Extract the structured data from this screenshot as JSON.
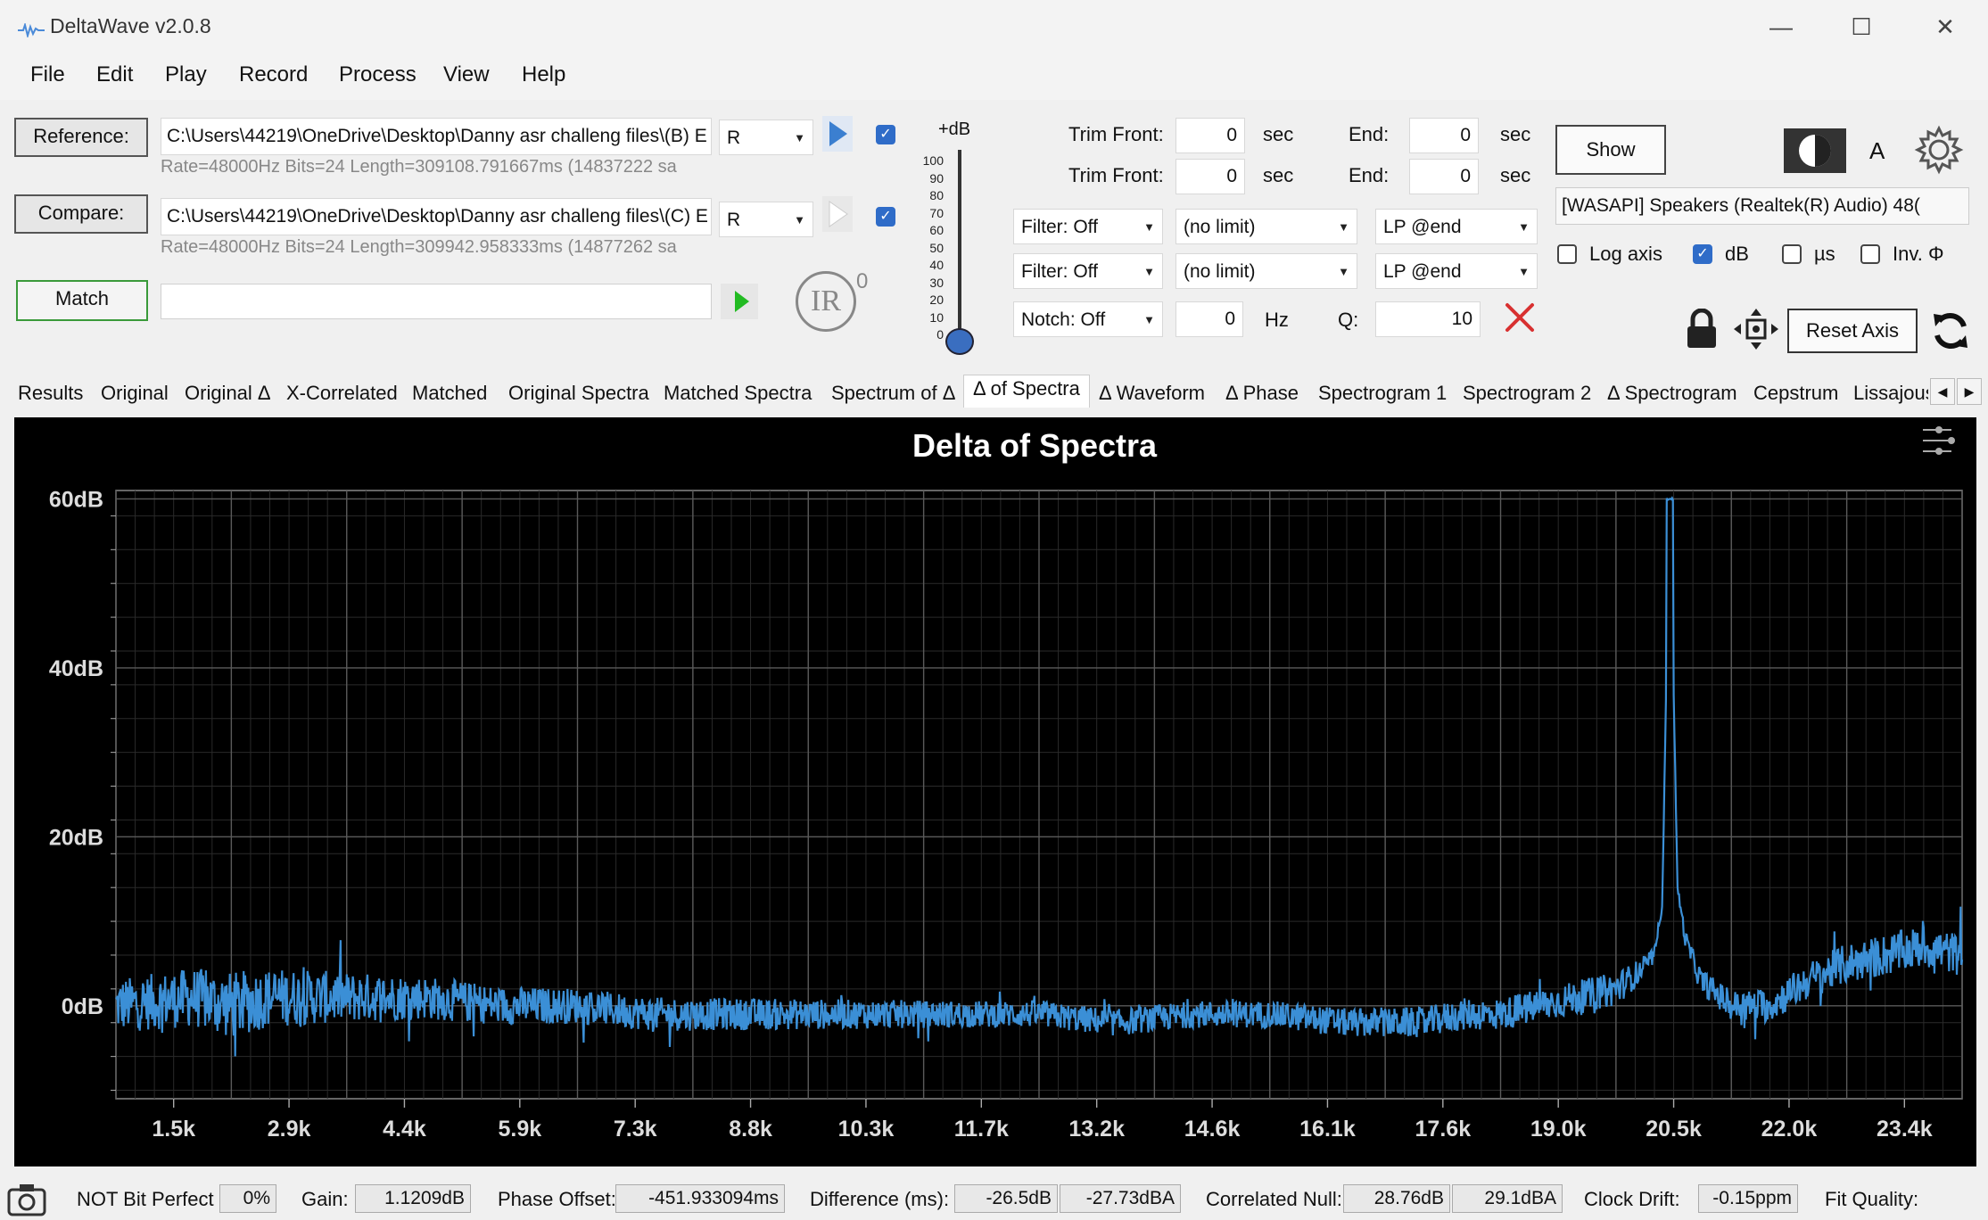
{
  "window": {
    "title": "DeltaWave v2.0.8",
    "minimize": "—",
    "maximize": "☐",
    "close": "✕"
  },
  "menu": [
    "File",
    "Edit",
    "Play",
    "Record",
    "Process",
    "View",
    "Help"
  ],
  "reference": {
    "button": "Reference:",
    "path": "C:\\Users\\44219\\OneDrive\\Desktop\\Danny asr challeng files\\(B) E",
    "channel": "R",
    "info": "Rate=48000Hz Bits=24 Length=309108.791667ms (14837222 sa"
  },
  "compare": {
    "button": "Compare:",
    "path": "C:\\Users\\44219\\OneDrive\\Desktop\\Danny asr challeng files\\(C) E",
    "channel": "R",
    "info": "Rate=48000Hz Bits=24 Length=309942.958333ms (14877262 sa"
  },
  "match": {
    "button": "Match",
    "ir_label": "IR",
    "ir_count": "0"
  },
  "level": {
    "label": "+dB",
    "ticks": [
      "100",
      "90",
      "80",
      "70",
      "60",
      "50",
      "40",
      "30",
      "20",
      "10",
      "0"
    ]
  },
  "trim": [
    {
      "label": "Trim Front:",
      "value": "0",
      "unit": "sec",
      "end_label": "End:",
      "end_value": "0",
      "end_unit": "sec"
    },
    {
      "label": "Trim Front:",
      "value": "0",
      "unit": "sec",
      "end_label": "End:",
      "end_value": "0",
      "end_unit": "sec"
    }
  ],
  "filters": [
    {
      "filter": "Filter: Off",
      "limit": "(no limit)",
      "lp": "LP @end"
    },
    {
      "filter": "Filter: Off",
      "limit": "(no limit)",
      "lp": "LP @end"
    }
  ],
  "notch": {
    "filter": "Notch: Off",
    "hz": "0",
    "hz_unit": "Hz",
    "q_label": "Q:",
    "q": "10"
  },
  "right_panel": {
    "show_button": "Show",
    "a_label": "A",
    "device": "[WASAPI] Speakers (Realtek(R) Audio) 48(",
    "log_axis": "Log axis",
    "db": "dB",
    "us": "µs",
    "inv": "Inv. Φ",
    "reset_axis": "Reset Axis"
  },
  "tabs": [
    "Results",
    "Original",
    "Original Δ",
    "X-Correlated",
    "Matched",
    "Original Spectra",
    "Matched Spectra",
    "Spectrum of Δ",
    "Δ of Spectra",
    "Δ Waveform",
    "Δ Phase",
    "Spectrogram 1",
    "Spectrogram 2",
    "Δ Spectrogram",
    "Cepstrum",
    "Lissajous"
  ],
  "active_tab": "Δ of Spectra",
  "chart_data": {
    "type": "line",
    "title": "Delta of Spectra",
    "xlabel": "",
    "ylabel": "",
    "x_ticks": [
      "1.5k",
      "2.9k",
      "4.4k",
      "5.9k",
      "7.3k",
      "8.8k",
      "10.3k",
      "11.7k",
      "13.2k",
      "14.6k",
      "16.1k",
      "17.6k",
      "19.0k",
      "20.5k",
      "22.0k",
      "23.4k"
    ],
    "y_ticks": [
      "60dB",
      "40dB",
      "20dB",
      "0dB"
    ],
    "xlim": [
      0,
      24000
    ],
    "ylim": [
      -11,
      61
    ],
    "grid": true,
    "series": [
      {
        "color": "#3b8fd6",
        "x": [
          0,
          1000,
          1500,
          2000,
          3000,
          4000,
          5000,
          6000,
          7000,
          8000,
          9000,
          10000,
          11000,
          12000,
          13000,
          14000,
          15000,
          16000,
          17000,
          17500,
          18000,
          18500,
          19000,
          19500,
          19800,
          20000,
          20100,
          20200,
          20300,
          20400,
          20600,
          21000,
          21500,
          22000,
          22500,
          23000,
          23500,
          24000
        ],
        "y": [
          0,
          1,
          0,
          1,
          1,
          1,
          0,
          0,
          -1,
          -1,
          -1,
          -1,
          -1,
          -1,
          -2,
          -1,
          -1,
          -2,
          -2,
          -1,
          -1,
          0,
          1,
          2,
          4,
          6,
          12,
          60,
          14,
          8,
          3,
          0,
          0,
          3,
          5,
          6,
          7,
          6
        ],
        "noise": [
          3.2,
          3.5,
          4.0,
          3.5,
          3.0,
          2.6,
          2.3,
          2.1,
          2.0,
          1.9,
          1.8,
          1.7,
          1.6,
          1.6,
          1.6,
          1.6,
          1.6,
          1.7,
          1.8,
          1.9,
          1.9,
          2.0,
          2.0,
          2.0,
          1.5,
          1.0,
          0.5,
          0.0,
          0.5,
          1.0,
          1.5,
          1.8,
          2.0,
          2.2,
          2.4,
          2.5,
          2.5,
          2.5
        ]
      }
    ]
  },
  "status": {
    "bit_perfect": "NOT Bit Perfect",
    "bit_perfect_value": "0%",
    "gain_label": "Gain:",
    "gain": "1.1209dB",
    "phase_label": "Phase Offset:",
    "phase": "-451.933094ms",
    "diff_label": "Difference (ms):",
    "diff1": "-26.5dB",
    "diff2": "-27.73dBA",
    "null_label": "Correlated Null:",
    "null1": "28.76dB",
    "null2": "29.1dBA",
    "drift_label": "Clock Drift:",
    "drift": "-0.15ppm",
    "fit_label": "Fit Quality:"
  }
}
